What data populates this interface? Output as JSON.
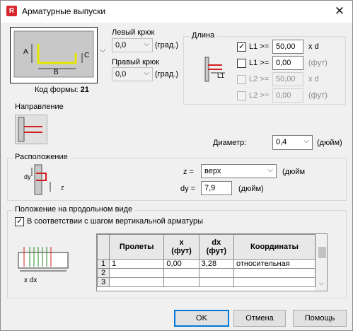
{
  "window": {
    "title": "Арматурные выпуски",
    "app_icon": "R"
  },
  "shape": {
    "code_label": "Код формы:",
    "code_value": "21",
    "dim_a": "A",
    "dim_b": "B",
    "dim_c": "C"
  },
  "hooks": {
    "left_label": "Левый крюк",
    "left_value": "0,0",
    "right_label": "Правый крюк",
    "right_value": "0,0",
    "unit": "(град.)"
  },
  "length": {
    "title": "Длина",
    "diagram_label": "L1",
    "rows": [
      {
        "label": "L1 >=",
        "value": "50,00",
        "unit": "x d",
        "checked": "true",
        "enabled": "true"
      },
      {
        "label": "L1 >=",
        "value": "0,00",
        "unit": "(фут)",
        "checked": "false",
        "enabled": "true"
      },
      {
        "label": "L2 >=",
        "value": "50,00",
        "unit": "x d",
        "checked": "false",
        "enabled": "false"
      },
      {
        "label": "L2 >=",
        "value": "0,00",
        "unit": "(фут)",
        "checked": "false",
        "enabled": "false"
      }
    ]
  },
  "direction": {
    "title": "Направление"
  },
  "diameter": {
    "label": "Диаметр:",
    "value": "0,4",
    "unit": "(дюйм)"
  },
  "position": {
    "title": "Расположение",
    "z_label": "z =",
    "z_value": "верх",
    "z_unit": "(дюйм",
    "dy_label": "dy =",
    "dy_value": "7,9",
    "dy_unit": "(дюйм)",
    "diagram_dy": "dy",
    "diagram_z": "z"
  },
  "longitudinal": {
    "title": "Положение на продольном виде",
    "checkbox_label": "В соответствии с шагом вертикальной арматуры",
    "checkbox_checked": "true",
    "diagram_label": "x dx",
    "table": {
      "headers": [
        "Пролеты",
        "x\n(фут)",
        "dx\n(фут)",
        "Координаты"
      ],
      "rows": [
        {
          "num": "1",
          "cells": [
            "1",
            "0,00",
            "3,28",
            "относительная"
          ]
        },
        {
          "num": "2",
          "cells": [
            "",
            "",
            "",
            ""
          ]
        },
        {
          "num": "3",
          "cells": [
            "",
            "",
            "",
            ""
          ]
        }
      ]
    }
  },
  "buttons": {
    "ok": "OK",
    "cancel": "Отмена",
    "help": "Помощь"
  },
  "colors": {
    "rebar": "#e6e600",
    "accent": "#0078d7",
    "hook_red": "#d22020",
    "concrete": "#c8c8c8"
  }
}
